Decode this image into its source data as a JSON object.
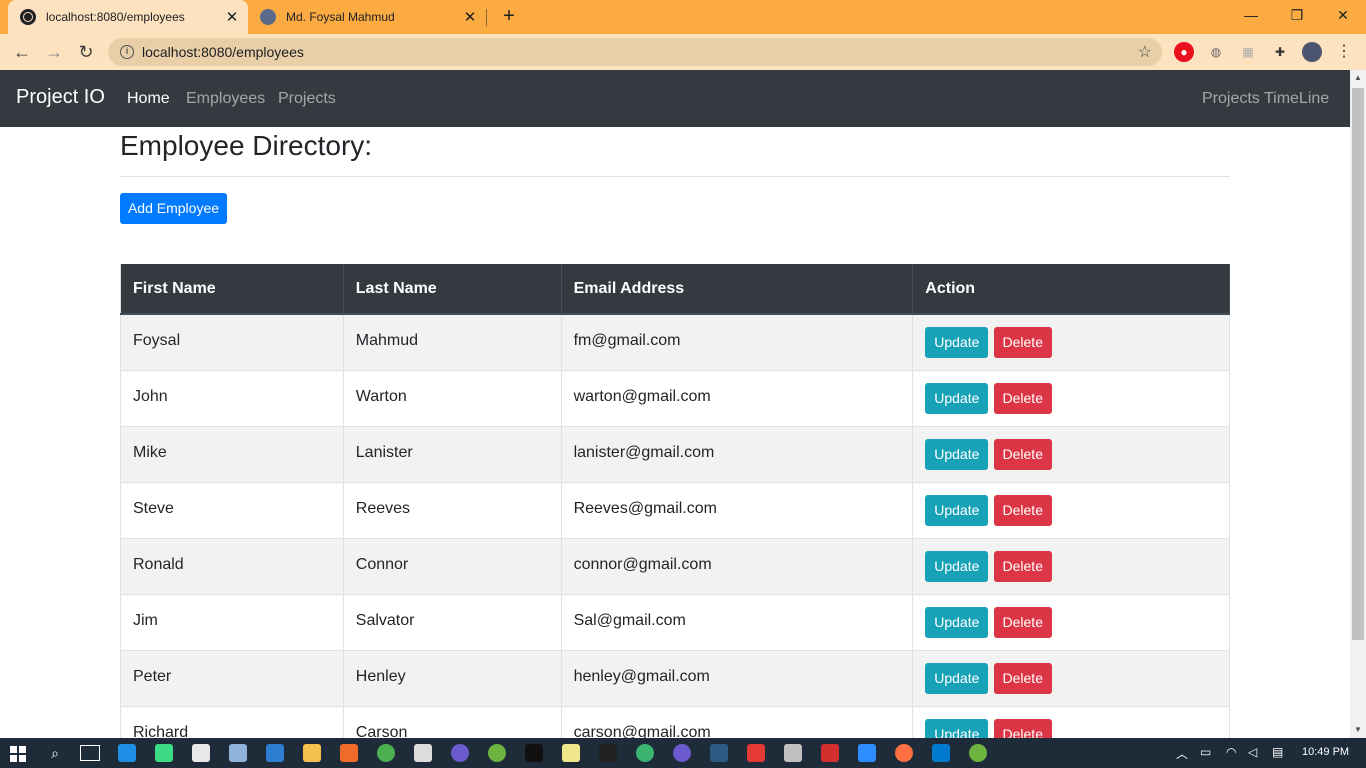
{
  "browser": {
    "tabs": [
      {
        "title": "localhost:8080/employees",
        "active": true
      },
      {
        "title": "Md. Foysal Mahmud",
        "active": false
      }
    ],
    "url": "localhost:8080/employees"
  },
  "navbar": {
    "brand": "Project IO",
    "links": [
      "Home",
      "Employees",
      "Projects"
    ],
    "right_link": "Projects TimeLine"
  },
  "page": {
    "title": "Employee Directory:",
    "add_button": "Add Employee"
  },
  "table": {
    "headers": [
      "First Name",
      "Last Name",
      "Email Address",
      "Action"
    ],
    "rows": [
      {
        "first": "Foysal",
        "last": "Mahmud",
        "email": "fm@gmail.com"
      },
      {
        "first": "John",
        "last": "Warton",
        "email": "warton@gmail.com"
      },
      {
        "first": "Mike",
        "last": "Lanister",
        "email": "lanister@gmail.com"
      },
      {
        "first": "Steve",
        "last": "Reeves",
        "email": "Reeves@gmail.com"
      },
      {
        "first": "Ronald",
        "last": "Connor",
        "email": "connor@gmail.com"
      },
      {
        "first": "Jim",
        "last": "Salvator",
        "email": "Sal@gmail.com"
      },
      {
        "first": "Peter",
        "last": "Henley",
        "email": "henley@gmail.com"
      },
      {
        "first": "Richard",
        "last": "Carson",
        "email": "carson@gmail.com"
      }
    ],
    "update_label": "Update",
    "delete_label": "Delete"
  },
  "taskbar": {
    "clock": "10:49 PM"
  },
  "colors": {
    "primary": "#007bff",
    "info": "#17a2b8",
    "danger": "#dc3545",
    "dark": "#343a40",
    "tabbar": "#fbab42"
  }
}
